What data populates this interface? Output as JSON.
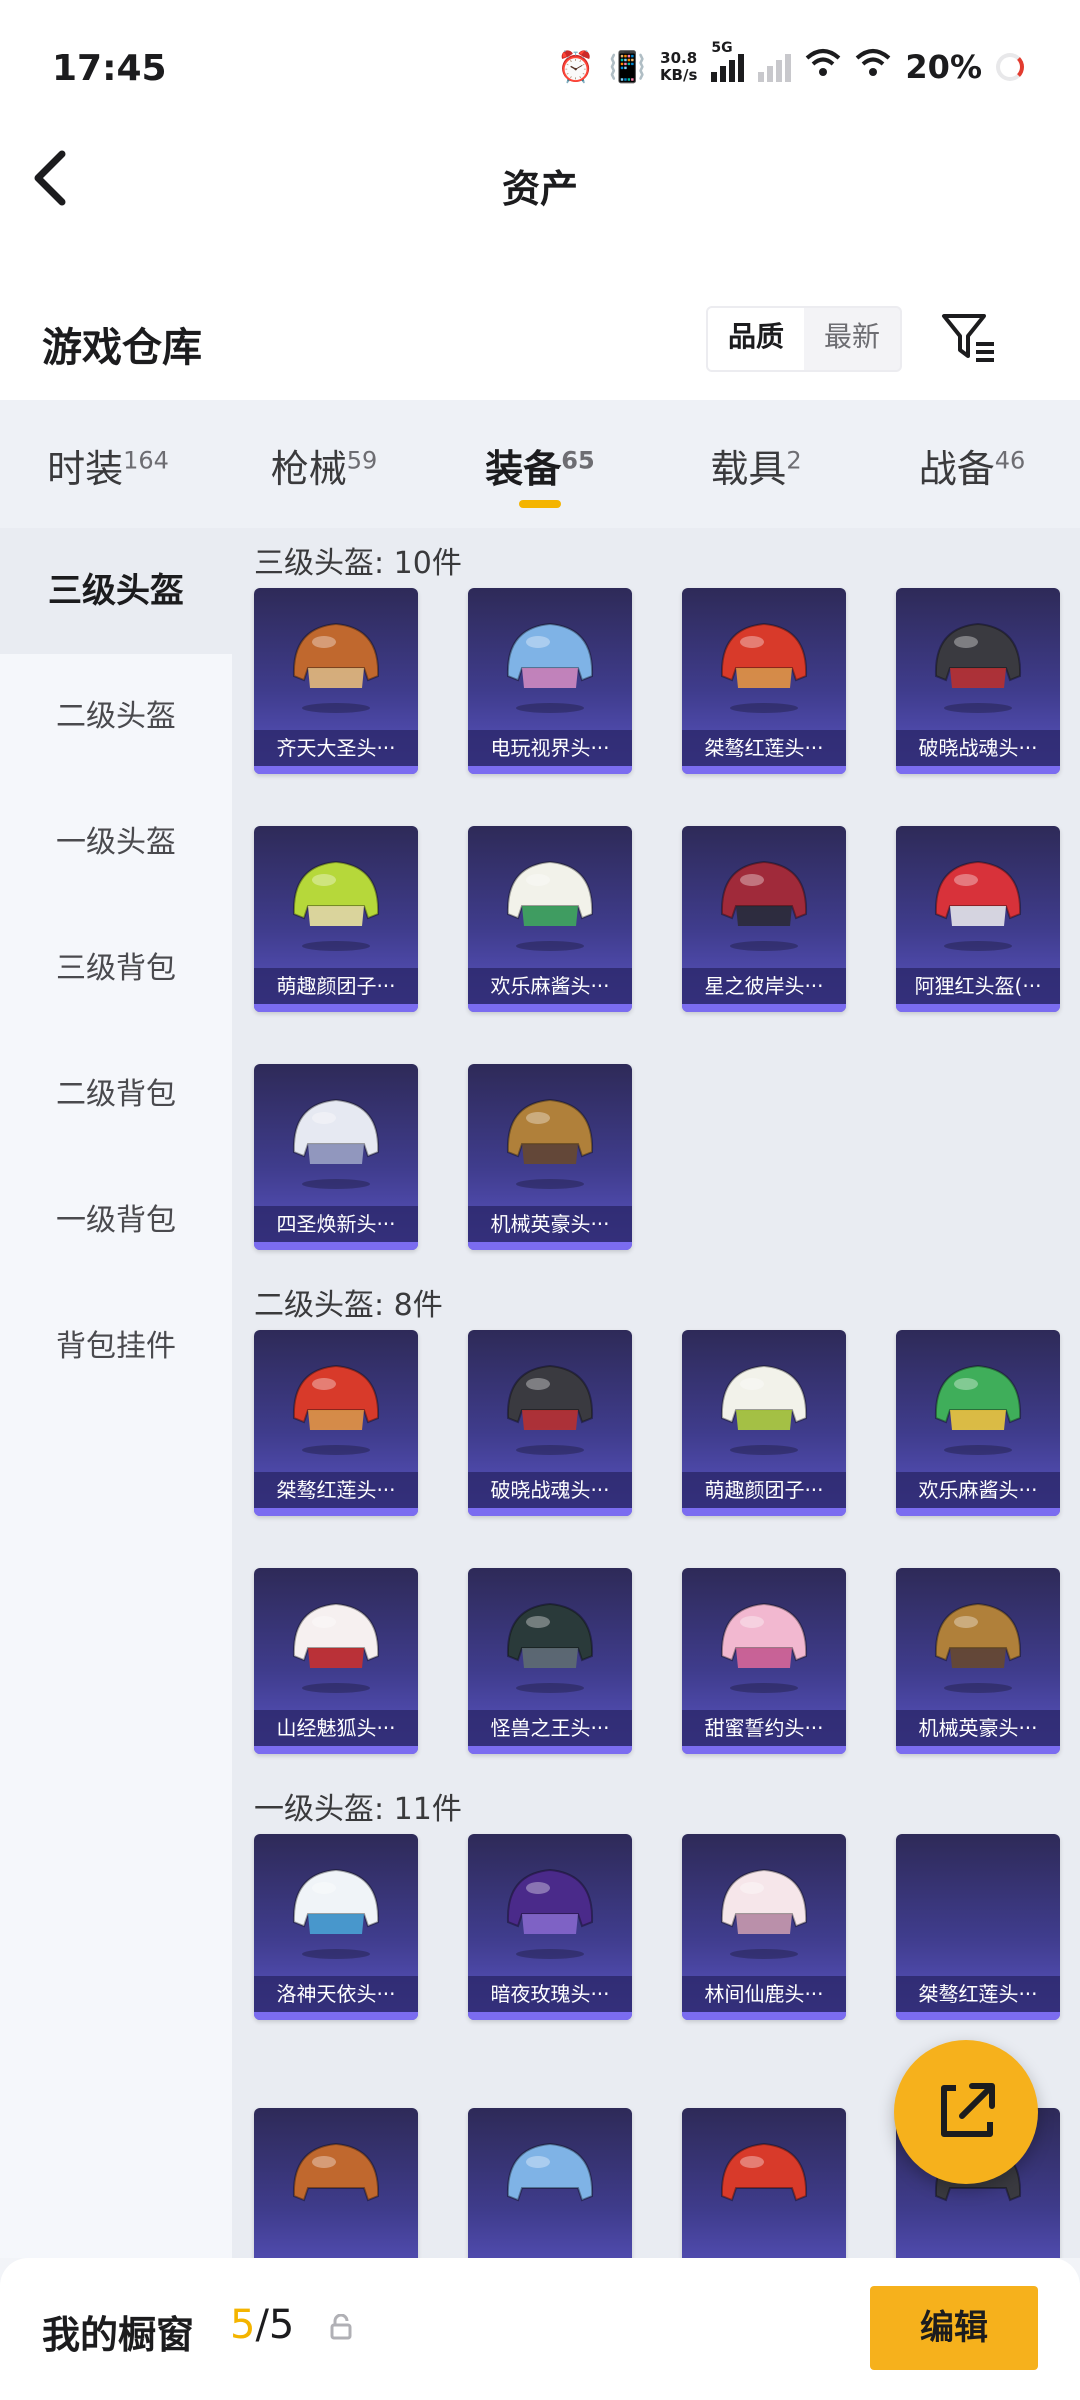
{
  "status_bar": {
    "time": "17:45",
    "net_speed_value": "30.8",
    "net_speed_unit": "KB/s",
    "network": "5G",
    "battery": "20%"
  },
  "nav": {
    "title": "资产"
  },
  "header": {
    "title": "游戏仓库",
    "sort_quality": "品质",
    "sort_newest": "最新"
  },
  "tabs": [
    {
      "label": "时装",
      "count": "164"
    },
    {
      "label": "枪械",
      "count": "59"
    },
    {
      "label": "装备",
      "count": "65"
    },
    {
      "label": "载具",
      "count": "2"
    },
    {
      "label": "战备",
      "count": "46"
    }
  ],
  "sidebar": [
    "三级头盔",
    "二级头盔",
    "一级头盔",
    "三级背包",
    "二级背包",
    "一级背包",
    "背包挂件"
  ],
  "groups": [
    {
      "title": "三级头盔: 10件",
      "items": [
        "齐天大圣头···",
        "电玩视界头···",
        "桀骜红莲头···",
        "破晓战魂头···",
        "萌趣颜团子···",
        "欢乐麻酱头···",
        "星之彼岸头···",
        "阿狸红头盔(···",
        "四圣焕新头···",
        "机械英豪头···"
      ]
    },
    {
      "title": "二级头盔: 8件",
      "items": [
        "桀骜红莲头···",
        "破晓战魂头···",
        "萌趣颜团子···",
        "欢乐麻酱头···",
        "山经魅狐头···",
        "怪兽之王头···",
        "甜蜜誓约头···",
        "机械英豪头···"
      ]
    },
    {
      "title": "一级头盔: 11件",
      "items": [
        "洛神天依头···",
        "暗夜玫瑰头···",
        "林间仙鹿头···",
        "桀骜红莲头···"
      ]
    }
  ],
  "bottom": {
    "label": "我的橱窗",
    "count_current": "5",
    "count_total": "/5",
    "edit": "编辑"
  },
  "colors": {
    "accent": "#f6b11c",
    "card_bg": "#3f3c8c"
  }
}
